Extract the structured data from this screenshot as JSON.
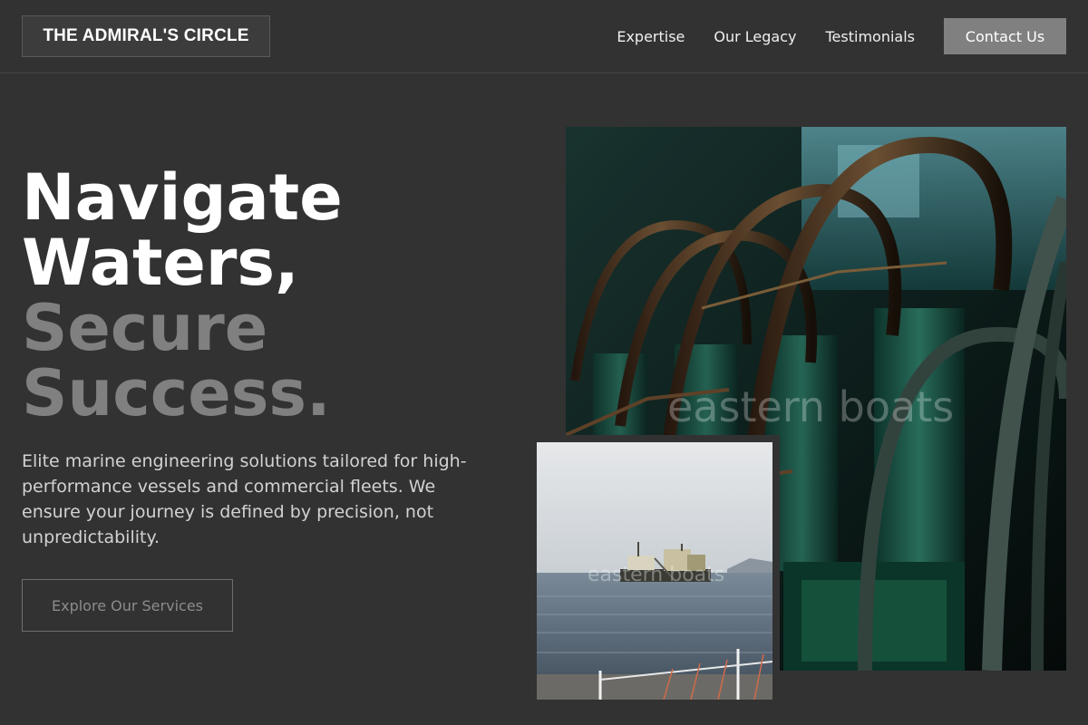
{
  "brand": {
    "name": "THE ADMIRAL'S CIRCLE"
  },
  "nav": {
    "items": [
      {
        "label": "Expertise"
      },
      {
        "label": "Our Legacy"
      },
      {
        "label": "Testimonials"
      }
    ],
    "contact_label": "Contact Us"
  },
  "hero": {
    "title_line1": "Navigate",
    "title_line2": "Waters,",
    "title_accent_line1": "Secure",
    "title_accent_line2": "Success.",
    "description": "Elite marine engineering solutions tailored for high-performance vessels and commercial fleets. We ensure your journey is defined by precision, not unpredictability.",
    "cta_label": "Explore Our Services"
  },
  "images": {
    "main_watermark": "eastern boats",
    "secondary_watermark": "eastern boats"
  },
  "colors": {
    "background": "#323232",
    "accent_text": "#808080",
    "button_bg": "#808080"
  }
}
